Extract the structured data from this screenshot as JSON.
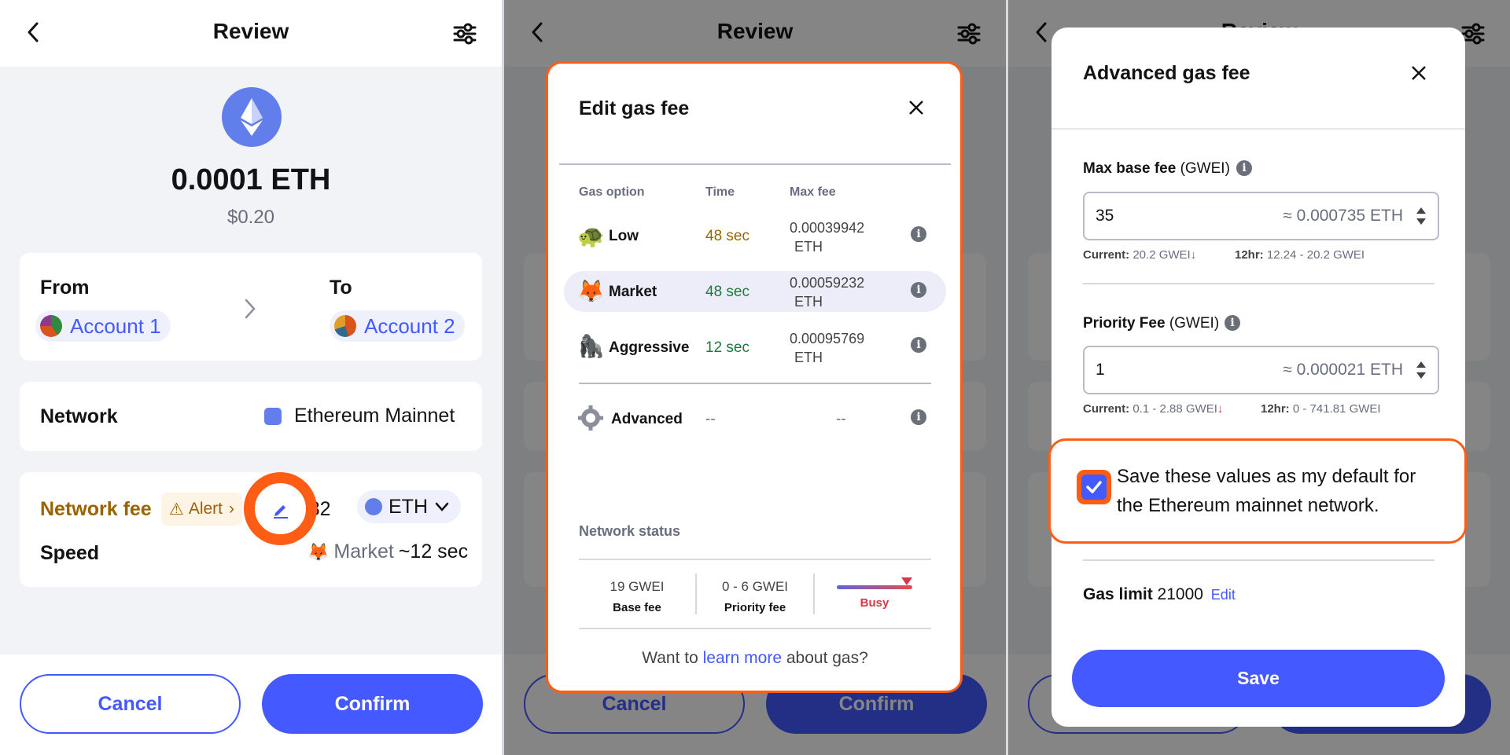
{
  "review": {
    "title": "Review",
    "amount": "0.0001 ETH",
    "fiat": "$0.20",
    "from_label": "From",
    "to_label": "To",
    "from_account": "Account 1",
    "to_account": "Account 2",
    "network_label": "Network",
    "network_value": "Ethereum Mainnet",
    "fee_label": "Network fee",
    "alert_label": "Alert",
    "fee_fiat": "$0.82",
    "fee_token": "ETH",
    "speed_label": "Speed",
    "speed_value": "Market",
    "speed_time": "~12 sec",
    "cancel": "Cancel",
    "confirm": "Confirm",
    "accent_color": "#4459ff",
    "highlight_color": "#ff5c16"
  },
  "edit_gas": {
    "title": "Edit gas fee",
    "headers": [
      "Gas option",
      "Time",
      "Max fee"
    ],
    "options": [
      {
        "icon": "turtle-icon",
        "name": "Low",
        "time": "48 sec",
        "fee_value": "0.00039942",
        "fee_unit": "ETH"
      },
      {
        "icon": "fox-icon",
        "name": "Market",
        "time": "48 sec",
        "fee_value": "0.00059232",
        "fee_unit": "ETH"
      },
      {
        "icon": "gorilla-icon",
        "name": "Aggressive",
        "time": "12 sec",
        "fee_value": "0.00095769",
        "fee_unit": "ETH"
      },
      {
        "icon": "gear-icon",
        "name": "Advanced",
        "time": "--",
        "fee_value": "--",
        "fee_unit": ""
      }
    ],
    "network_status_label": "Network status",
    "base_fee_value": "19 GWEI",
    "base_fee_label": "Base fee",
    "priority_fee_value": "0 - 6 GWEI",
    "priority_fee_label": "Priority fee",
    "busy_label": "Busy",
    "learn_prefix": "Want to ",
    "learn_link": "learn more",
    "learn_suffix": " about gas?"
  },
  "advanced": {
    "title": "Advanced gas fee",
    "max_base_label": "Max base fee",
    "max_base_unit": "(GWEI)",
    "max_base_value": "35",
    "max_base_eth": "≈ 0.000735 ETH",
    "max_base_current_label": "Current:",
    "max_base_current_value": "20.2 GWEI",
    "max_base_12hr_label": "12hr:",
    "max_base_12hr_value": "12.24 - 20.2 GWEI",
    "priority_label": "Priority Fee",
    "priority_unit": "(GWEI)",
    "priority_value": "1",
    "priority_eth": "≈ 0.000021 ETH",
    "priority_current_label": "Current:",
    "priority_current_value": "0.1 - 2.88 GWEI",
    "priority_12hr_label": "12hr:",
    "priority_12hr_value": "0 - 741.81 GWEI",
    "save_default_text": "Save these values as my default for the Ethereum mainnet network.",
    "save_default_checked": true,
    "gas_limit_label": "Gas limit",
    "gas_limit_value": "21000",
    "edit_link": "Edit",
    "save_button": "Save"
  }
}
